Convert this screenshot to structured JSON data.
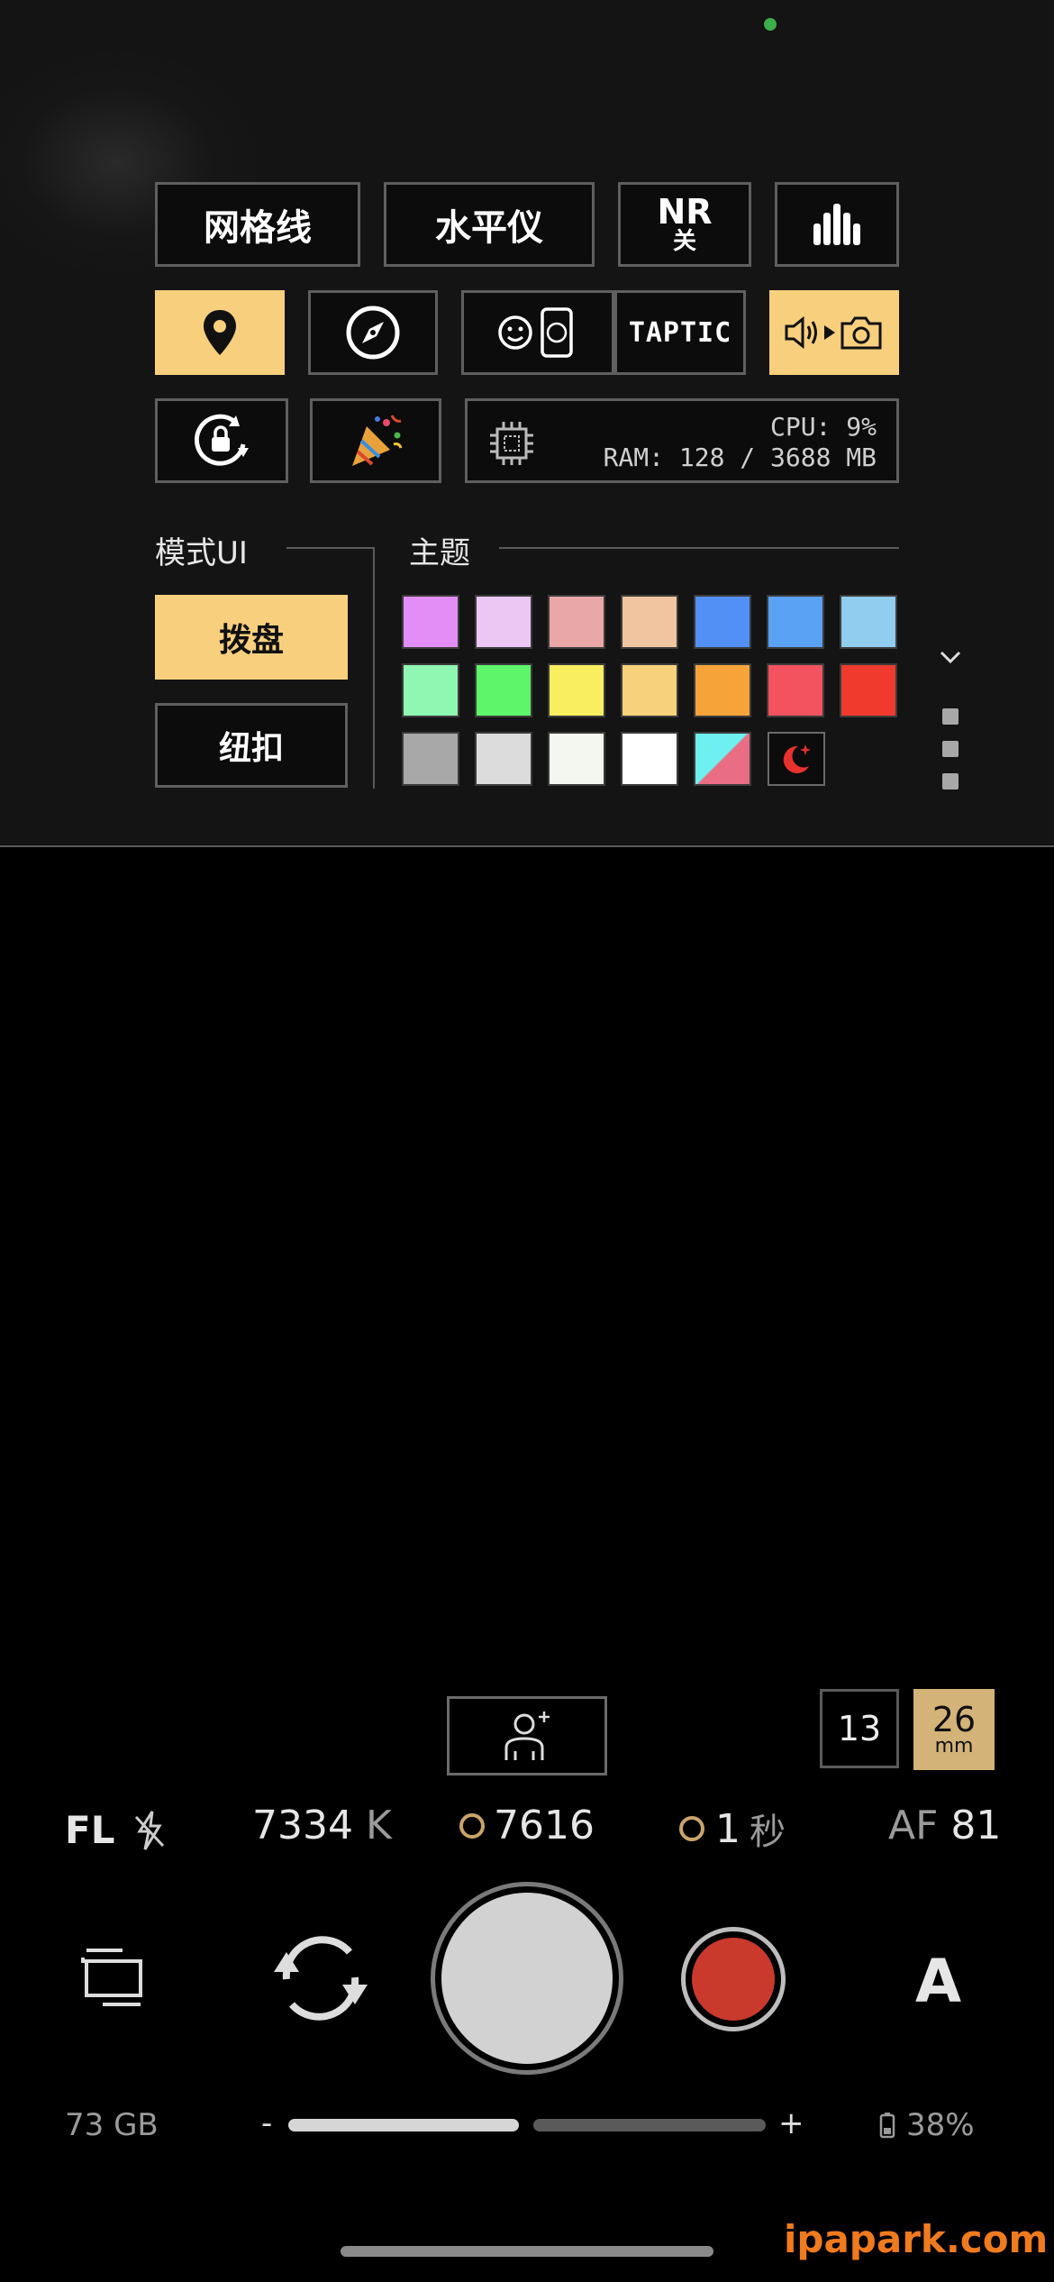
{
  "quick": {
    "grid_label": "网格线",
    "level_label": "水平仪",
    "nr_title": "NR",
    "nr_state": "关",
    "taptic_label": "TAPTIC",
    "cpu_text": "CPU: 9%",
    "ram_text": "RAM: 128 / 3688 MB"
  },
  "modeui": {
    "title": "模式UI",
    "option_dial": "拨盘",
    "option_button": "纽扣"
  },
  "theme": {
    "title": "主题",
    "swatches": [
      "#e38ef6",
      "#ecc7f4",
      "#e9a7a8",
      "#f1c59f",
      "#5290f5",
      "#5aa2f3",
      "#91cdef",
      "#8ff7b1",
      "#5ef56a",
      "#f8ee5f",
      "#f8d17b",
      "#f6a43a",
      "#f2535e",
      "#f03a2d",
      "#a8a8a8",
      "#dcdcdc",
      "#f4f6f0",
      "#ffffff"
    ]
  },
  "lens": {
    "wide": "13",
    "main": "26",
    "main_unit": "mm"
  },
  "status": {
    "fl": "FL",
    "kelvin": "7334",
    "kelvin_unit": "K",
    "iso": "7616",
    "shutter": "1",
    "shutter_unit": "秒",
    "af": "AF",
    "af_value": "81"
  },
  "controls": {
    "auto_label": "A"
  },
  "footer": {
    "storage": "73 GB",
    "zoom_minus": "-",
    "zoom_plus": "+",
    "battery": "38%"
  },
  "watermark": "ipapark.com",
  "colors": {
    "accent": "#f8cf7d",
    "record": "#c93a2c",
    "lens_active": "#d3b377"
  }
}
